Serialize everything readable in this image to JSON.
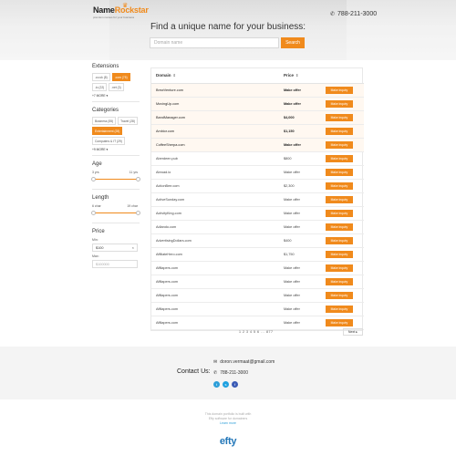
{
  "header": {
    "logo_name_a": "Name",
    "logo_name_b": "Rockstar",
    "logo_tagline": "premium names for your business",
    "phone": "788-211-3000",
    "title": "Find a unique name for your business:",
    "search_placeholder": "Domain name",
    "search_button": "Search"
  },
  "sidebar": {
    "extensions": {
      "title": "Extensions",
      "chips": [
        {
          "label": ".co.uk (8)",
          "active": false
        },
        {
          "label": ".com (75)",
          "active": true
        },
        {
          "label": ".io (22)",
          "active": false
        },
        {
          "label": ".net (3)",
          "active": false
        }
      ],
      "more": "+7 MORE ▾"
    },
    "categories": {
      "title": "Categories",
      "chips": [
        {
          "label": "Business (55)",
          "active": false
        },
        {
          "label": "Travel (28)",
          "active": false
        },
        {
          "label": "Entertainment (28)",
          "active": true
        },
        {
          "label": "Computers & IT (29)",
          "active": false
        }
      ],
      "more": "+9 MORE ▾"
    },
    "age": {
      "title": "Age",
      "min": "3 yrs",
      "max": "11 yrs"
    },
    "length": {
      "title": "Length",
      "min": "6 char",
      "max": "19 char"
    },
    "price": {
      "title": "Price",
      "min_label": "Min:",
      "min_value": "$100",
      "max_label": "Max:",
      "max_placeholder": "$100000"
    }
  },
  "table": {
    "col_domain": "Domain",
    "col_price": "Price",
    "inquiry_label": "Make inquiry",
    "rows": [
      {
        "domain": "BrewVenture.com",
        "price": "Make offer",
        "featured": true
      },
      {
        "domain": "MovingUp.com",
        "price": "Make offer",
        "featured": true
      },
      {
        "domain": "BandManager.com",
        "price": "$4,000",
        "featured": true
      },
      {
        "domain": "Ambior.com",
        "price": "$1,150",
        "featured": true
      },
      {
        "domain": "CoffeeSherpa.com",
        "price": "Make offer",
        "featured": true
      },
      {
        "domain": "Aberdeen.pub",
        "price": "$800",
        "featured": false
      },
      {
        "domain": "Abroad.io",
        "price": "Make offer",
        "featured": false
      },
      {
        "domain": "ActionBee.com",
        "price": "$2,300",
        "featured": false
      },
      {
        "domain": "ActiveSunday.com",
        "price": "Make offer",
        "featured": false
      },
      {
        "domain": "ActivityKing.com",
        "price": "Make offer",
        "featured": false
      },
      {
        "domain": "Adlando.com",
        "price": "Make offer",
        "featured": false
      },
      {
        "domain": "AdvertisingDollars.com",
        "price": "$400",
        "featured": false
      },
      {
        "domain": "AffiliateHero.com",
        "price": "$1,750",
        "featured": false
      },
      {
        "domain": "Affliapers.com",
        "price": "Make offer",
        "featured": false
      },
      {
        "domain": "Affliapers.com",
        "price": "Make offer",
        "featured": false
      },
      {
        "domain": "Affliapers.com",
        "price": "Make offer",
        "featured": false
      },
      {
        "domain": "Affliapers.com",
        "price": "Make offer",
        "featured": false
      },
      {
        "domain": "Affliapers.com",
        "price": "Make offer",
        "featured": false
      }
    ]
  },
  "pagination": {
    "pages": "1 2 3 4 5 6 ... 877",
    "next": "Next ▸"
  },
  "footer": {
    "email": "doron.vermaat@gmail.com",
    "contact_label": "Contact Us:",
    "phone": "788-211-3000",
    "note_line1": "This domain portfolio is built with",
    "note_line2": "Efty software for domainers",
    "learn_more": "Learn more",
    "brand": "efty"
  },
  "colors": {
    "accent": "#f08a1c",
    "link": "#2d9fd9"
  }
}
